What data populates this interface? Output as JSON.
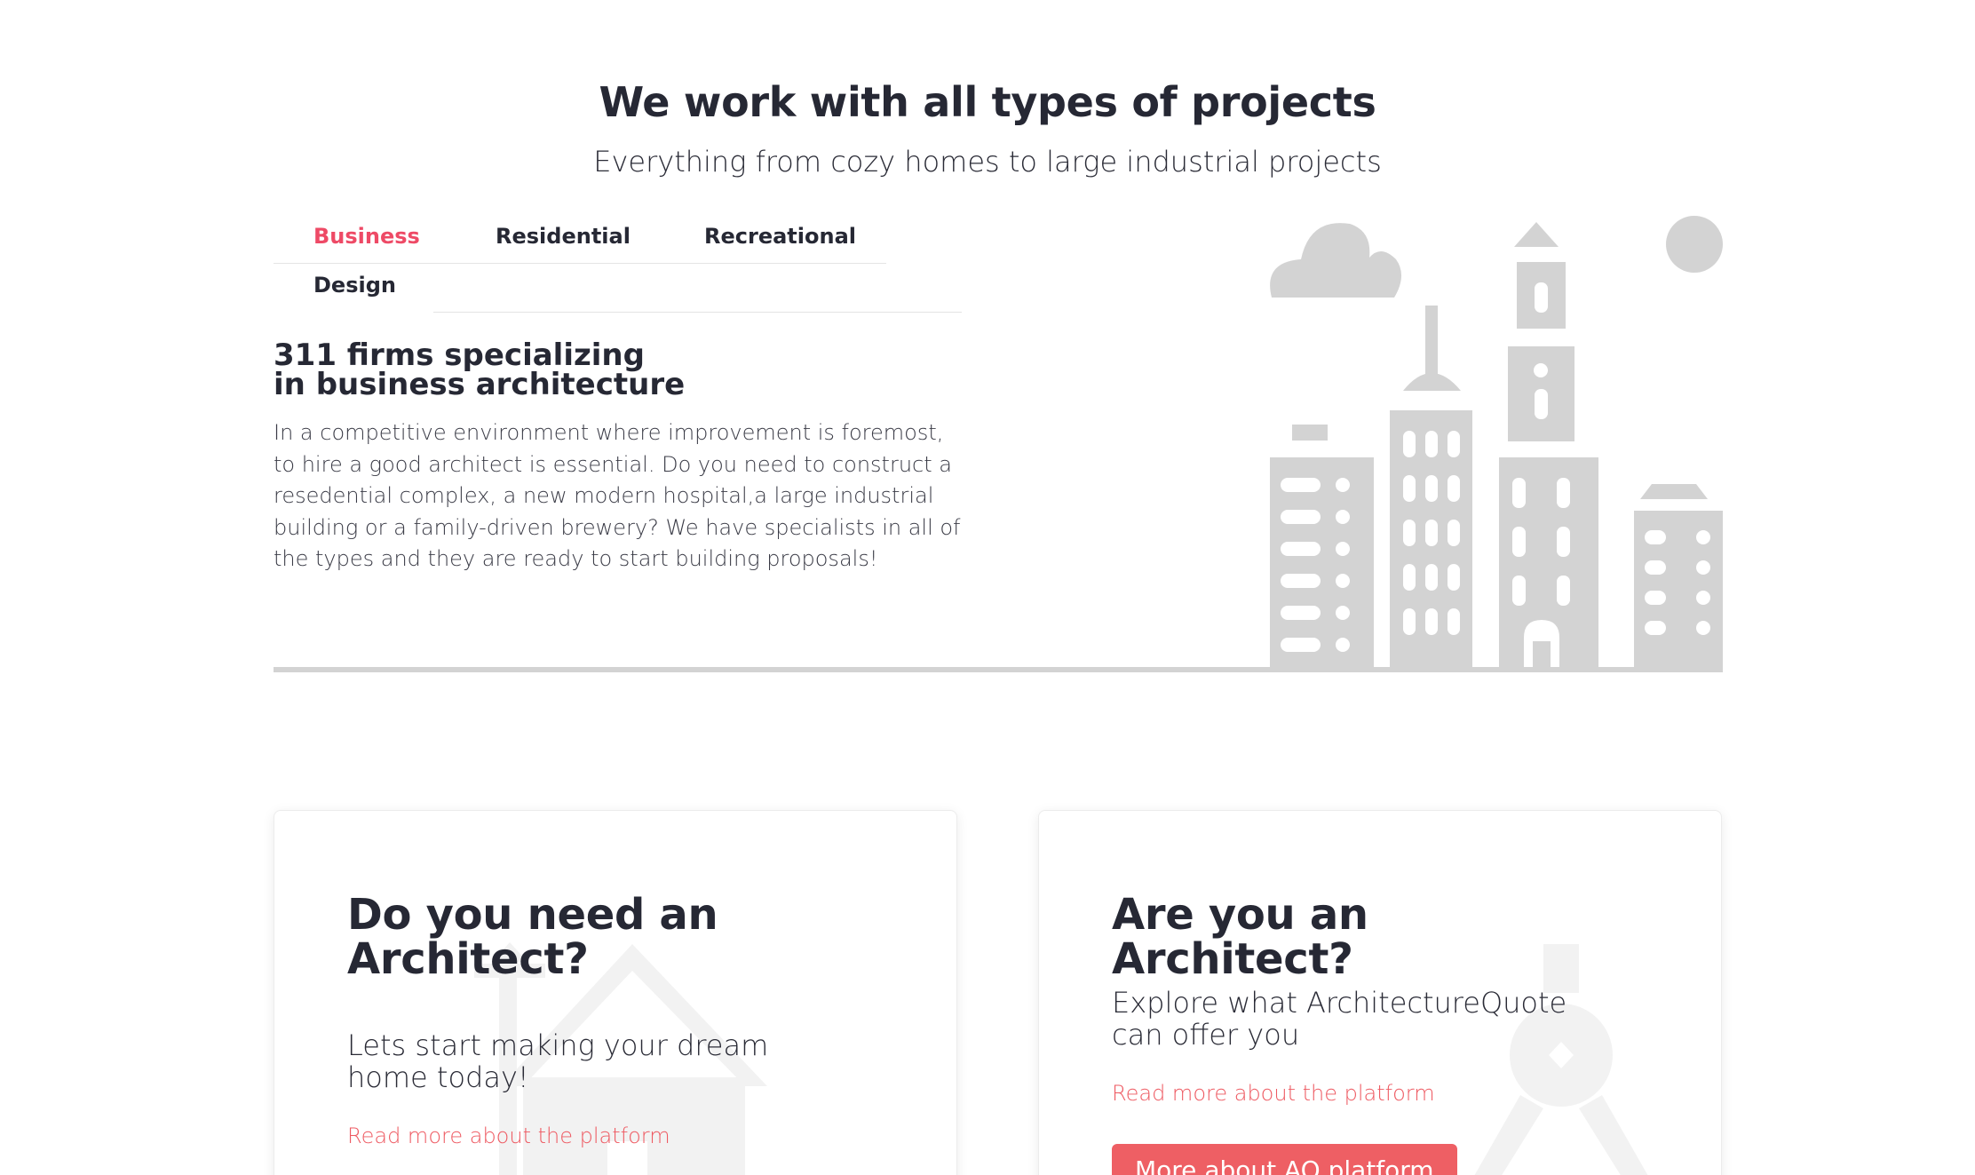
{
  "header": {
    "title": "We work with all types of projects",
    "subtitle": "Everything from cozy homes to large industrial projects"
  },
  "tabs": [
    {
      "label": "Business",
      "active": true
    },
    {
      "label": "Residential",
      "active": false
    },
    {
      "label": "Recreational",
      "active": false
    },
    {
      "label": "Design",
      "active": false
    }
  ],
  "section": {
    "title_line1": "311 firms specializing",
    "title_line2": "in business architecture",
    "body": "In a competitive environment where improvement is foremost, to hire a good architect is essential. Do you need to construct a resedential complex, a new modern hospital,a large industrial building or a family-driven brewery? We have specialists in all of the types and they are ready to start building proposals!"
  },
  "cards": {
    "client": {
      "title_line1": "Do you need an",
      "title_line2": "Architect?",
      "text_line1": "Lets start making your dream",
      "text_line2": "home today!",
      "link": "Read more about the platform"
    },
    "architect": {
      "title": "Are you an Architect?",
      "text_line1": "Explore what ArchitectureQuote",
      "text_line2": "can offer you",
      "link": "Read more about the platform",
      "button": "More about AQ platform"
    }
  },
  "colors": {
    "accent": "#ee4a66",
    "button": "#ee5f64",
    "heading": "#262834",
    "illustration": "#d3d3d3"
  },
  "icons": [
    "city-skyline-illustration",
    "house-icon",
    "drafting-compass-icon"
  ]
}
